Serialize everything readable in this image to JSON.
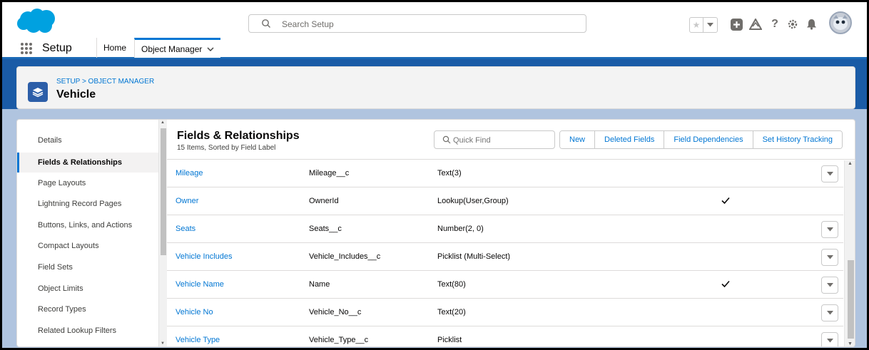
{
  "header": {
    "search_placeholder": "Search Setup",
    "brand_color": "#00a1e0"
  },
  "context_bar": {
    "app_name": "Setup",
    "tabs": [
      {
        "label": "Home"
      },
      {
        "label": "Object Manager"
      }
    ]
  },
  "page_header": {
    "breadcrumb": "SETUP > OBJECT MANAGER",
    "title": "Vehicle"
  },
  "sidebar": {
    "items": [
      {
        "label": "Details"
      },
      {
        "label": "Fields & Relationships"
      },
      {
        "label": "Page Layouts"
      },
      {
        "label": "Lightning Record Pages"
      },
      {
        "label": "Buttons, Links, and Actions"
      },
      {
        "label": "Compact Layouts"
      },
      {
        "label": "Field Sets"
      },
      {
        "label": "Object Limits"
      },
      {
        "label": "Record Types"
      },
      {
        "label": "Related Lookup Filters"
      }
    ],
    "selected_index": 1
  },
  "content": {
    "title": "Fields & Relationships",
    "subtitle": "15 Items, Sorted by Field Label",
    "quick_find_placeholder": "Quick Find",
    "buttons": {
      "new": "New",
      "deleted_fields": "Deleted Fields",
      "field_dependencies": "Field Dependencies",
      "set_history_tracking": "Set History Tracking"
    },
    "rows": [
      {
        "label": "Mileage",
        "api_name": "Mileage__c",
        "type": "Text(3)",
        "indexed": false,
        "has_menu": true
      },
      {
        "label": "Owner",
        "api_name": "OwnerId",
        "type": "Lookup(User,Group)",
        "indexed": true,
        "has_menu": false
      },
      {
        "label": "Seats",
        "api_name": "Seats__c",
        "type": "Number(2, 0)",
        "indexed": false,
        "has_menu": true
      },
      {
        "label": "Vehicle Includes",
        "api_name": "Vehicle_Includes__c",
        "type": "Picklist (Multi-Select)",
        "indexed": false,
        "has_menu": true
      },
      {
        "label": "Vehicle Name",
        "api_name": "Name",
        "type": "Text(80)",
        "indexed": true,
        "has_menu": true
      },
      {
        "label": "Vehicle No",
        "api_name": "Vehicle_No__c",
        "type": "Text(20)",
        "indexed": false,
        "has_menu": true
      },
      {
        "label": "Vehicle Type",
        "api_name": "Vehicle_Type__c",
        "type": "Picklist",
        "indexed": false,
        "has_menu": true
      }
    ]
  },
  "colors": {
    "link": "#0176d3",
    "header_band": "#1a5ba6",
    "icon_tile": "#2c5ea8"
  }
}
